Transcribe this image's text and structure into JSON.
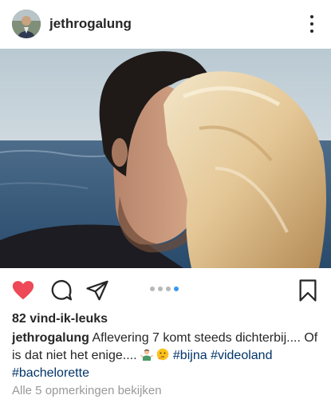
{
  "header": {
    "username": "jethrogalung"
  },
  "icons": {
    "avatar": "profile-avatar",
    "more": "more-options-icon",
    "like": "heart-filled-icon",
    "comment": "comment-bubble-icon",
    "share": "paper-plane-icon",
    "save": "bookmark-icon"
  },
  "colors": {
    "like_red": "#ed4956",
    "hashtag": "#003569",
    "carousel_active": "#3897f0",
    "carousel_inactive": "#b8b8b8",
    "muted_text": "#999999"
  },
  "carousel": {
    "total": 4,
    "active_index": 3
  },
  "post": {
    "likes": "82 vind-ik-leuks",
    "caption_user": "jethrogalung",
    "caption_text": "Aflevering 7 komt steeds dichterbij.... Of is dat niet het enige....",
    "hashtags": [
      "#bijna",
      "#videoland",
      "#bachelorette"
    ],
    "view_comments": "Alle 5 opmerkingen bekijken"
  }
}
